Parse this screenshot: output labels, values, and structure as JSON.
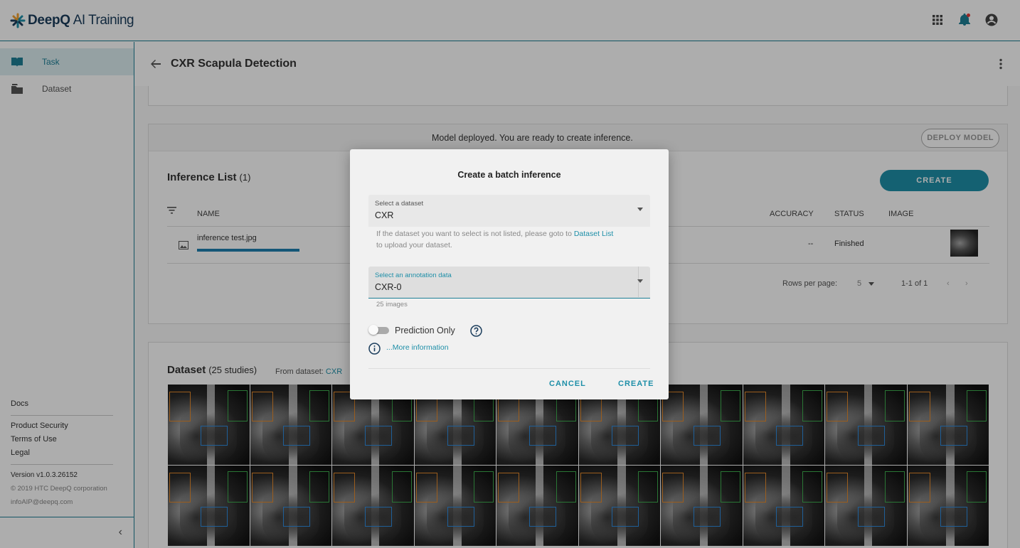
{
  "app": {
    "brand": "DeepQ",
    "product": "AI Training"
  },
  "sidebar": {
    "items": [
      {
        "label": "Task",
        "icon": "book-icon",
        "active": true
      },
      {
        "label": "Dataset",
        "icon": "folder-icon",
        "active": false
      }
    ],
    "footer": {
      "docs": "Docs",
      "product_security": "Product Security",
      "terms": "Terms of Use",
      "legal": "Legal",
      "version": "Version v1.0.3.26152",
      "copyright": "© 2019 HTC DeepQ corporation",
      "email": "infoAIP@deepq.com"
    },
    "collapse_icon": "‹"
  },
  "page": {
    "title": "CXR Scapula Detection"
  },
  "deploy": {
    "message": "Model deployed. You are ready to create inference.",
    "button": "DEPLOY MODEL"
  },
  "inference": {
    "title": "Inference List",
    "count": "(1)",
    "create_label": "CREATE",
    "columns": {
      "name": "NAME",
      "accuracy": "ACCURACY",
      "status": "STATUS",
      "image": "IMAGE"
    },
    "rows": [
      {
        "name": "inference test.jpg",
        "accuracy": "--",
        "status": "Finished"
      }
    ],
    "pagination": {
      "rows_per_page_label": "Rows per page:",
      "rows_per_page": "5",
      "range": "1-1 of 1"
    }
  },
  "dataset_section": {
    "title": "Dataset",
    "count": "(25 studies)",
    "from_label": "From dataset:",
    "from_value": "CXR"
  },
  "dialog": {
    "title": "Create a batch inference",
    "dataset_select": {
      "label": "Select a dataset",
      "value": "CXR"
    },
    "dataset_help_prefix": "If the dataset you want to select is not listed, please goto to",
    "dataset_help_link": "Dataset List",
    "dataset_help_suffix": "to upload your dataset.",
    "annotation_select": {
      "label": "Select an annotation data",
      "value": "CXR-0"
    },
    "annotation_help": "25 images",
    "toggle_label": "Prediction Only",
    "toggle_on": false,
    "more_info": "...More information",
    "cancel_label": "CANCEL",
    "create_label": "CREATE"
  },
  "colors": {
    "accent": "#1e8fa8",
    "brand": "#1b3d5c",
    "notification": "#e53935"
  }
}
